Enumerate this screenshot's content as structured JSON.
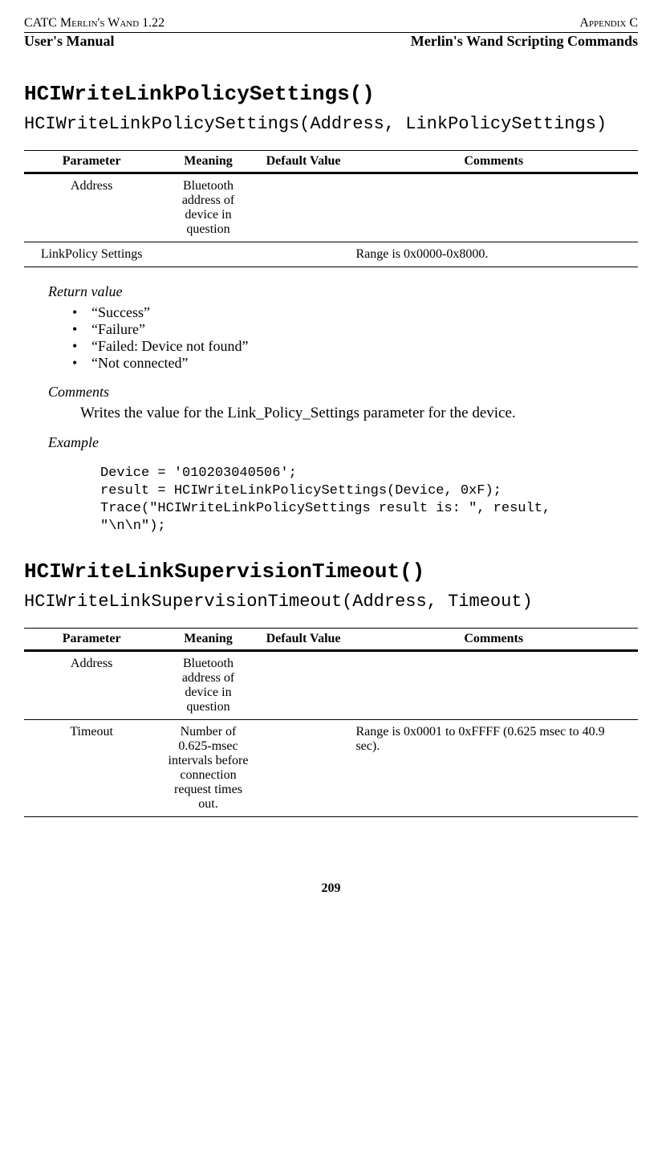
{
  "header": {
    "left_top": "CATC Merlin's Wand 1.22",
    "right_top": "Appendix C",
    "left_sub": "User's Manual",
    "right_sub": "Merlin's Wand Scripting Commands"
  },
  "sections": [
    {
      "title": "HCIWriteLinkPolicySettings()",
      "signature": "HCIWriteLinkPolicySettings(Address, LinkPolicySettings)",
      "table": {
        "headers": [
          "Parameter",
          "Meaning",
          "Default Value",
          "Comments"
        ],
        "rows": [
          {
            "param": "Address",
            "meaning": "Bluetooth address of device in question",
            "default": "",
            "comments": ""
          },
          {
            "param": "LinkPolicy Settings",
            "meaning": "",
            "default": "",
            "comments": "Range is 0x0000-0x8000."
          }
        ]
      },
      "return_label": "Return value",
      "return_values": [
        "“Success”",
        "“Failure”",
        "“Failed: Device not found”",
        "“Not connected”"
      ],
      "comments_label": "Comments",
      "comments_text": "Writes the value for the Link_Policy_Settings parameter for the device.",
      "example_label": "Example",
      "example_code": "Device = '010203040506';\nresult = HCIWriteLinkPolicySettings(Device, 0xF);\nTrace(\"HCIWriteLinkPolicySettings result is: \", result,\n\"\\n\\n\");"
    },
    {
      "title": "HCIWriteLinkSupervisionTimeout()",
      "signature": "HCIWriteLinkSupervisionTimeout(Address, Timeout)",
      "table": {
        "headers": [
          "Parameter",
          "Meaning",
          "Default Value",
          "Comments"
        ],
        "rows": [
          {
            "param": "Address",
            "meaning": "Bluetooth address of device in question",
            "default": "",
            "comments": ""
          },
          {
            "param": "Timeout",
            "meaning": "Number of 0.625-msec intervals before connection request times out.",
            "default": "",
            "comments": "Range is 0x0001 to 0xFFFF (0.625 msec to 40.9 sec)."
          }
        ]
      }
    }
  ],
  "page_number": "209"
}
